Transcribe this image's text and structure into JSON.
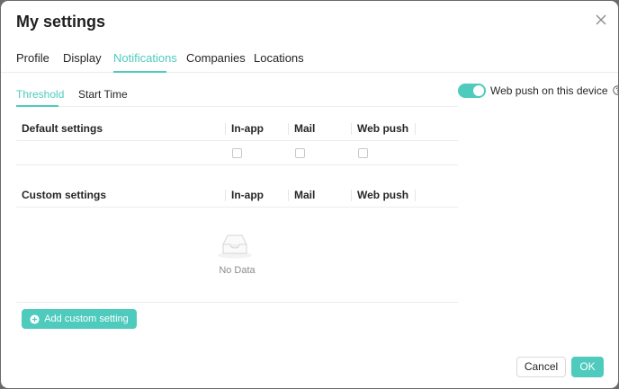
{
  "dialog": {
    "title": "My settings"
  },
  "tabs": {
    "items": [
      "Profile",
      "Display",
      "Notifications",
      "Companies",
      "Locations"
    ],
    "active": "Notifications"
  },
  "subtabs": {
    "items": [
      "Threshold",
      "Start Time"
    ],
    "active": "Threshold"
  },
  "web_push_toggle": {
    "label": "Web push on this device",
    "enabled": true
  },
  "default_table": {
    "headers": [
      "Default settings",
      "In-app",
      "Mail",
      "Web push"
    ],
    "rows": [
      {
        "label": "",
        "in_app": false,
        "mail": false,
        "web_push": false
      }
    ]
  },
  "custom_table": {
    "headers": [
      "Custom settings",
      "In-app",
      "Mail",
      "Web push"
    ],
    "empty_text": "No Data"
  },
  "add_custom_label": "Add custom setting",
  "footer": {
    "cancel": "Cancel",
    "ok": "OK"
  },
  "colors": {
    "accent": "#4ecbbd",
    "border": "#ececec",
    "muted_text": "#8c8c8c"
  }
}
